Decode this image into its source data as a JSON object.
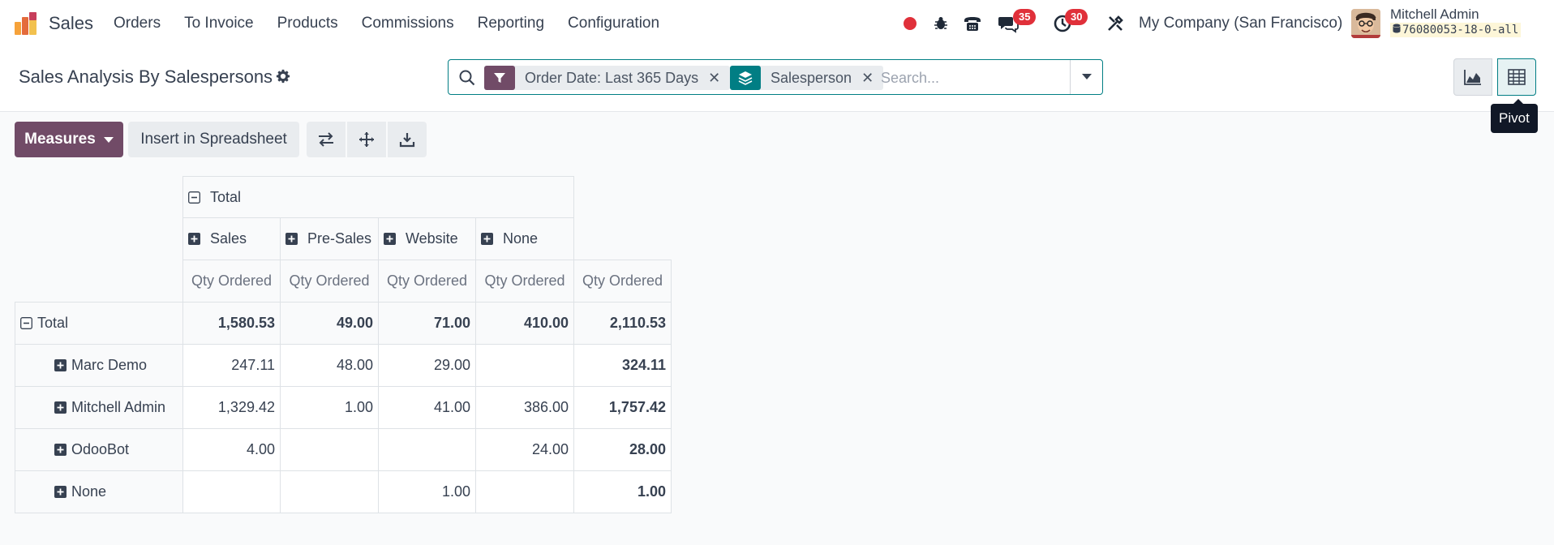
{
  "navbar": {
    "app_name": "Sales",
    "menu": [
      "Orders",
      "To Invoice",
      "Products",
      "Commissions",
      "Reporting",
      "Configuration"
    ],
    "messages_count": "35",
    "activities_count": "30",
    "company": "My Company (San Francisco)",
    "user_name": "Mitchell Admin",
    "database": "76080053-18-0-all"
  },
  "control": {
    "title": "Sales Analysis By Salespersons",
    "facets": [
      {
        "label": "Order Date: Last 365 Days",
        "icon": "filter-icon",
        "color": "#714b67"
      },
      {
        "label": "Salesperson",
        "icon": "group-by-icon",
        "color": "#017e84"
      }
    ],
    "search_placeholder": "Search...",
    "tooltip": "Pivot"
  },
  "toolbar": {
    "measures_label": "Measures",
    "insert_label": "Insert in Spreadsheet"
  },
  "pivot": {
    "col_total_label": "Total",
    "col_groups": [
      "Sales",
      "Pre-Sales",
      "Website",
      "None"
    ],
    "measure_label": "Qty Ordered",
    "rows": [
      {
        "label": "Total",
        "values": [
          "1,580.53",
          "49.00",
          "71.00",
          "410.00"
        ],
        "total": "2,110.53"
      },
      {
        "label": "Marc Demo",
        "values": [
          "247.11",
          "48.00",
          "29.00",
          ""
        ],
        "total": "324.11"
      },
      {
        "label": "Mitchell Admin",
        "values": [
          "1,329.42",
          "1.00",
          "41.00",
          "386.00"
        ],
        "total": "1,757.42"
      },
      {
        "label": "OdooBot",
        "values": [
          "4.00",
          "",
          "",
          "24.00"
        ],
        "total": "28.00"
      },
      {
        "label": "None",
        "values": [
          "",
          "",
          "1.00",
          ""
        ],
        "total": "1.00"
      }
    ]
  },
  "colors": {
    "brand": "#714b67",
    "accent": "#017e84",
    "badge": "#e0303a"
  }
}
